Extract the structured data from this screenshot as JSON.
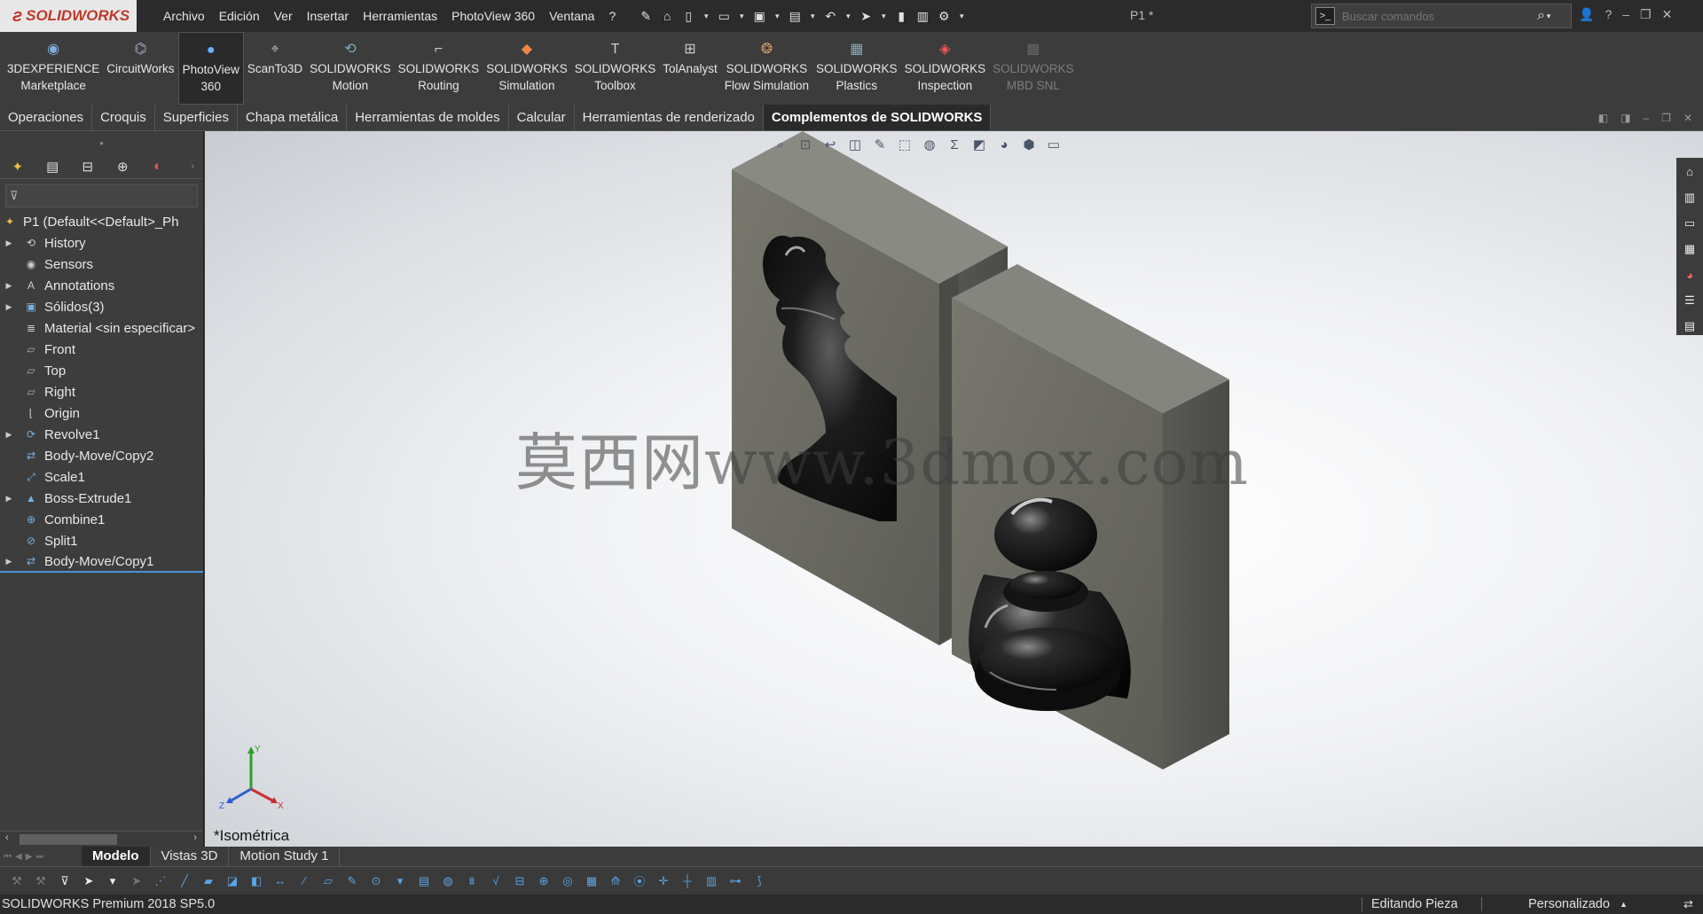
{
  "app": {
    "logo_text": "SOLIDWORKS",
    "doc_title": "P1 *"
  },
  "menu": [
    "Archivo",
    "Edición",
    "Ver",
    "Insertar",
    "Herramientas",
    "PhotoView 360",
    "Ventana",
    "?"
  ],
  "search": {
    "placeholder": "Buscar comandos"
  },
  "commands": [
    {
      "line1": "3DEXPERIENCE",
      "line2": "Marketplace",
      "icon": "marketplace-icon"
    },
    {
      "line1": "CircuitWorks",
      "line2": "",
      "icon": "circuitworks-icon"
    },
    {
      "line1": "PhotoView",
      "line2": "360",
      "icon": "photoview-icon",
      "active": true
    },
    {
      "line1": "ScanTo3D",
      "line2": "",
      "icon": "scanto3d-icon"
    },
    {
      "line1": "SOLIDWORKS",
      "line2": "Motion",
      "icon": "motion-icon"
    },
    {
      "line1": "SOLIDWORKS",
      "line2": "Routing",
      "icon": "routing-icon"
    },
    {
      "line1": "SOLIDWORKS",
      "line2": "Simulation",
      "icon": "simulation-icon"
    },
    {
      "line1": "SOLIDWORKS",
      "line2": "Toolbox",
      "icon": "toolbox-icon"
    },
    {
      "line1": "TolAnalyst",
      "line2": "",
      "icon": "tolanalyst-icon"
    },
    {
      "line1": "SOLIDWORKS",
      "line2": "Flow Simulation",
      "icon": "flow-simulation-icon"
    },
    {
      "line1": "SOLIDWORKS",
      "line2": "Plastics",
      "icon": "plastics-icon"
    },
    {
      "line1": "SOLIDWORKS",
      "line2": "Inspection",
      "icon": "inspection-icon"
    },
    {
      "line1": "SOLIDWORKS",
      "line2": "MBD SNL",
      "icon": "mbd-snl-icon",
      "disabled": true
    }
  ],
  "tabs": [
    "Operaciones",
    "Croquis",
    "Superficies",
    "Chapa metálica",
    "Herramientas de moldes",
    "Calcular",
    "Herramientas de renderizado",
    "Complementos de SOLIDWORKS"
  ],
  "active_tab": "Complementos de SOLIDWORKS",
  "feature_tree": [
    {
      "label": "P1  (Default<<Default>_Ph",
      "icon": "part-icon",
      "expand": false,
      "root": true
    },
    {
      "label": "History",
      "icon": "history-icon",
      "expand": true
    },
    {
      "label": "Sensors",
      "icon": "sensors-icon",
      "expand": false
    },
    {
      "label": "Annotations",
      "icon": "annotations-icon",
      "expand": true
    },
    {
      "label": "Sólidos(3)",
      "icon": "solid-bodies-icon",
      "expand": true
    },
    {
      "label": "Material <sin especificar>",
      "icon": "material-icon",
      "expand": false
    },
    {
      "label": "Front",
      "icon": "plane-icon",
      "expand": false
    },
    {
      "label": "Top",
      "icon": "plane-icon",
      "expand": false
    },
    {
      "label": "Right",
      "icon": "plane-icon",
      "expand": false
    },
    {
      "label": "Origin",
      "icon": "origin-icon",
      "expand": false
    },
    {
      "label": "Revolve1",
      "icon": "revolve-icon",
      "expand": true
    },
    {
      "label": "Body-Move/Copy2",
      "icon": "move-copy-icon",
      "expand": false
    },
    {
      "label": "Scale1",
      "icon": "scale-icon",
      "expand": false
    },
    {
      "label": "Boss-Extrude1",
      "icon": "extrude-icon",
      "expand": true
    },
    {
      "label": "Combine1",
      "icon": "combine-icon",
      "expand": false
    },
    {
      "label": "Split1",
      "icon": "split-icon",
      "expand": false
    },
    {
      "label": "Body-Move/Copy1",
      "icon": "move-copy-icon",
      "expand": true,
      "selected": true
    }
  ],
  "viewport": {
    "watermark": "莫西网www.3dmox.com",
    "view_label": "*Isométrica",
    "triad": {
      "x": "X",
      "y": "Y",
      "z": "Z"
    }
  },
  "bottom_tabs": [
    "Modelo",
    "Vistas 3D",
    "Motion Study 1"
  ],
  "active_bottom_tab": "Modelo",
  "status": {
    "version": "SOLIDWORKS Premium 2018 SP5.0",
    "mode": "Editando Pieza",
    "units": "Personalizado"
  },
  "colors": {
    "accent": "#4a90d9",
    "brand": "#c0392b",
    "mold": "#6f6f6b",
    "piece": "#1a1a1a"
  }
}
